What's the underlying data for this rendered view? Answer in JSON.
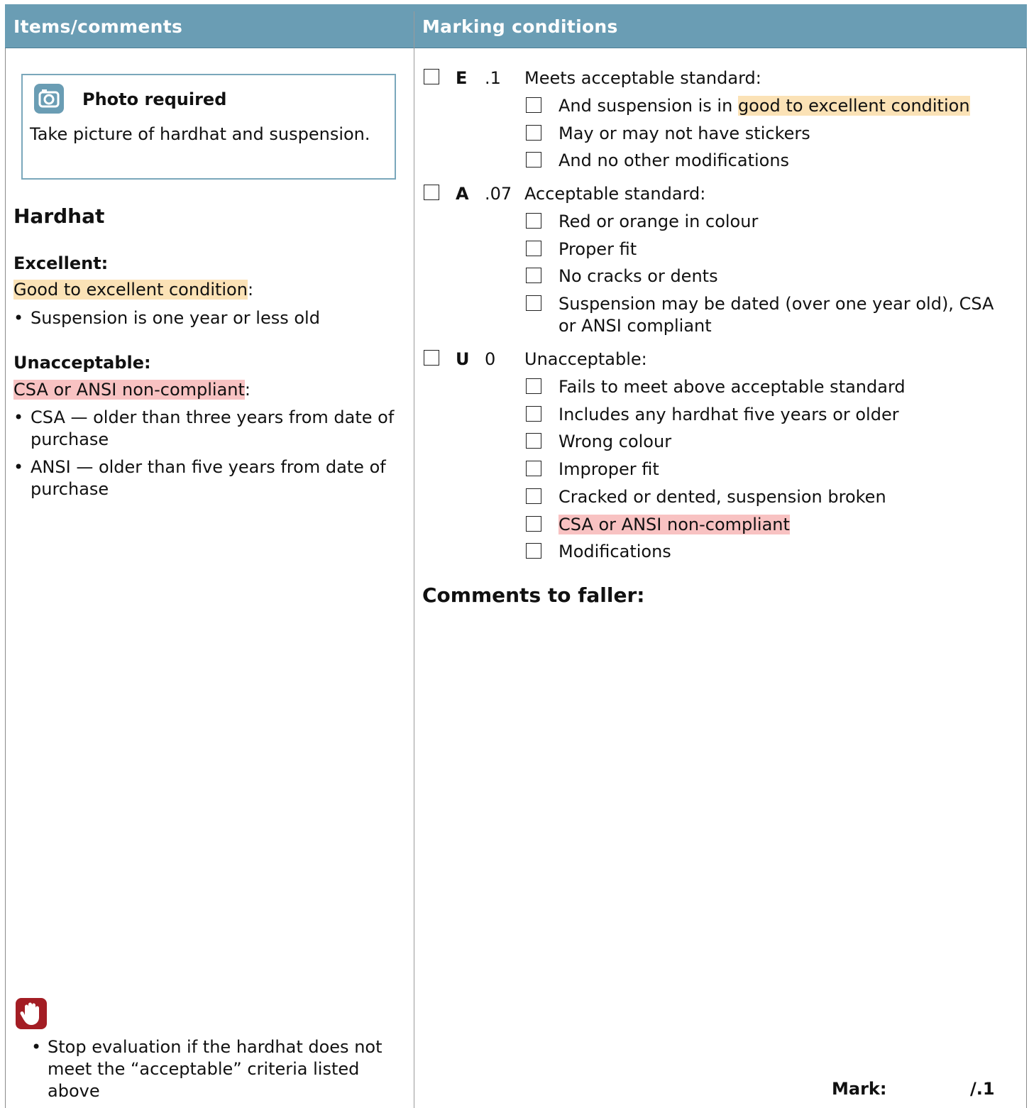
{
  "header": {
    "left_title": "Items/comments",
    "right_title": "Marking conditions"
  },
  "left": {
    "photo": {
      "icon": "camera-icon",
      "title": "Photo required",
      "text": "Take picture of hardhat and suspension."
    },
    "section_title": "Hardhat",
    "excellent": {
      "heading": "Excellent:",
      "highlight": "Good to excellent condition",
      "suffix": ":",
      "bullets": [
        "Suspension is one year or less old"
      ]
    },
    "unacceptable": {
      "heading": "Unacceptable:",
      "highlight": "CSA or ANSI non-compliant",
      "suffix": ":",
      "bullets": [
        "CSA — older than three years from date of purchase",
        "ANSI — older than five years from date of purchase"
      ]
    },
    "stop": {
      "icon": "stop-hand-icon",
      "text": "Stop evaluation if the hardhat does not meet the “acceptable” criteria listed above"
    }
  },
  "right": {
    "grades": [
      {
        "letter": "E",
        "points": ".1",
        "label": "Meets acceptable standard:",
        "criteria": [
          {
            "prefix": "And suspension is in ",
            "highlight": "good to excellent condition",
            "highlight_color": "#fbe2b6"
          },
          {
            "prefix": "May or may not have stickers"
          },
          {
            "prefix": "And no other modifications"
          }
        ]
      },
      {
        "letter": "A",
        "points": ".07",
        "label": "Acceptable standard:",
        "criteria": [
          {
            "prefix": "Red or orange in colour"
          },
          {
            "prefix": "Proper fit"
          },
          {
            "prefix": "No cracks or dents"
          },
          {
            "prefix": "Suspension may be dated (over one year old), CSA or ANSI compliant"
          }
        ]
      },
      {
        "letter": "U",
        "points": "0",
        "label": "Unacceptable:",
        "criteria": [
          {
            "prefix": "Fails to meet above acceptable standard"
          },
          {
            "prefix": "Includes any hardhat five years or older"
          },
          {
            "prefix": "Wrong colour"
          },
          {
            "prefix": "Improper fit"
          },
          {
            "prefix": "Cracked or dented, suspension broken"
          },
          {
            "prefix": "",
            "highlight": "CSA or ANSI non-compliant",
            "highlight_color": "#f8c2c2"
          },
          {
            "prefix": "Modifications"
          }
        ]
      }
    ],
    "comments_label": "Comments to faller:",
    "mark_label": "Mark:",
    "mark_total": "/.1"
  },
  "colors": {
    "header": "#6a9db4",
    "highlight_good": "#fbe2b6",
    "highlight_bad": "#f8c2c2",
    "stop_icon": "#a31d24"
  }
}
